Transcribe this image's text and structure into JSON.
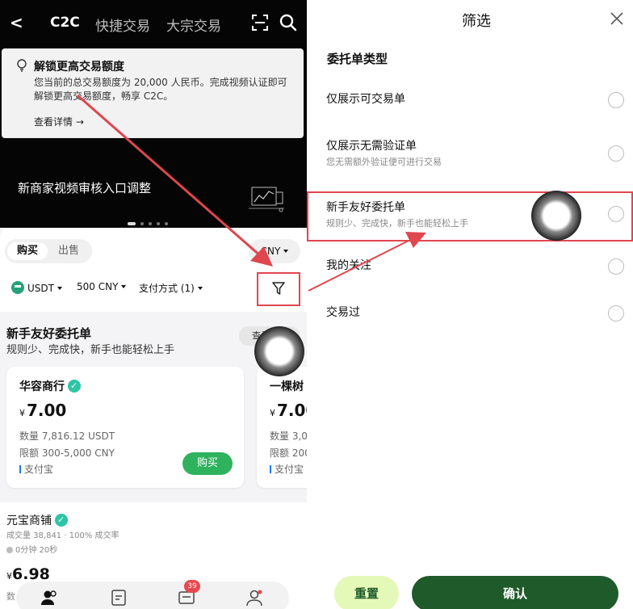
{
  "left": {
    "nav": {
      "back": "<",
      "tabs": [
        "C2C",
        "快捷交易",
        "大宗交易"
      ]
    },
    "notice": {
      "title": "解锁更高交易额度",
      "body": "您当前的总交易额度为 20,000 人民币。完成视频认证即可解锁更高交易额度，畅享 C2C。",
      "link": "查看详情 →"
    },
    "banner": {
      "text": "新商家视频审核入口调整"
    },
    "segment": {
      "buy": "购买",
      "sell": "出售"
    },
    "currency": "CNY",
    "filters": {
      "coin": "USDT",
      "amount": "500 CNY",
      "payment": "支付方式 (1)"
    },
    "friendly": {
      "title": "新手友好委托单",
      "subtitle": "规则少、完成快，新手也能轻松上手",
      "view_btn": "查看"
    },
    "card1": {
      "name": "华容商行",
      "currency_symbol": "¥",
      "price": "7.00",
      "qty": "数量 7,816.12 USDT",
      "limit": "限额 300-5,000 CNY",
      "payment": "支付宝",
      "buy": "购买"
    },
    "card2": {
      "name": "一棵树",
      "currency_symbol": "¥",
      "price": "7.00",
      "qty": "数量 3,0",
      "limit": "限额 200",
      "payment": "支付宝"
    },
    "shop": {
      "name": "元宝商铺",
      "stats": "成交量 38,841 · 100% 成交率",
      "time": "0分钟 20秒",
      "currency_symbol": "¥",
      "price": "6.98",
      "qty": "数"
    },
    "tabbar": {
      "badge": "39"
    }
  },
  "right": {
    "title": "筛选",
    "section": "委托单类型",
    "options": [
      {
        "label": "仅展示可交易单",
        "desc": ""
      },
      {
        "label": "仅展示无需验证单",
        "desc": "您无需额外验证便可进行交易"
      },
      {
        "label": "新手友好委托单",
        "desc": "规则少、完成快，新手也能轻松上手"
      },
      {
        "label": "我的关注",
        "desc": ""
      },
      {
        "label": "交易过",
        "desc": ""
      }
    ],
    "reset": "重置",
    "confirm": "确认"
  },
  "colors": {
    "accent_green": "#2fb25d",
    "confirm_green": "#1f5a2a",
    "reset_lime": "#e4f8b8",
    "highlight_red": "#e0464e"
  }
}
